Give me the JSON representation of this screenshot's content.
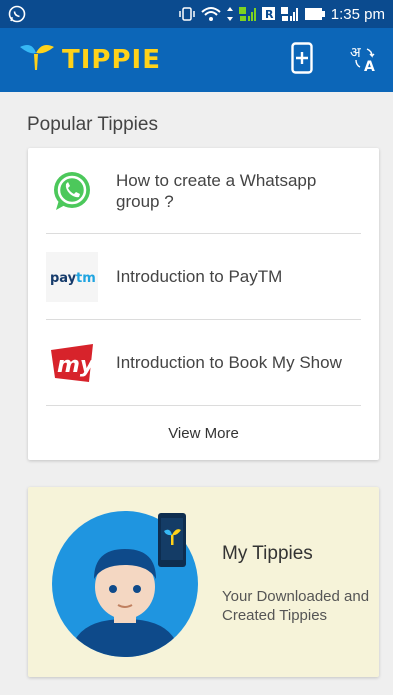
{
  "status_bar": {
    "time": "1:35 pm"
  },
  "app_bar": {
    "brand": "TIPPIE",
    "icons": [
      "add-device-icon",
      "language-icon"
    ]
  },
  "popular": {
    "heading": "Popular Tippies",
    "items": [
      {
        "title": "How to create a Whatsapp group ?",
        "icon": "whatsapp-logo-icon"
      },
      {
        "title": "Introduction to PayTM",
        "icon": "paytm-logo-icon"
      },
      {
        "title": "Introduction to Book My Show",
        "icon": "bookmyshow-logo-icon"
      }
    ],
    "view_more": "View More"
  },
  "my_tippies": {
    "title": "My Tippies",
    "subtitle": "Your Downloaded and Created Tippies"
  },
  "colors": {
    "status_bar": "#0b4b8f",
    "app_bar": "#0c66b8",
    "brand_yellow": "#ffd21a",
    "my_card_bg": "#f6f3d9"
  }
}
